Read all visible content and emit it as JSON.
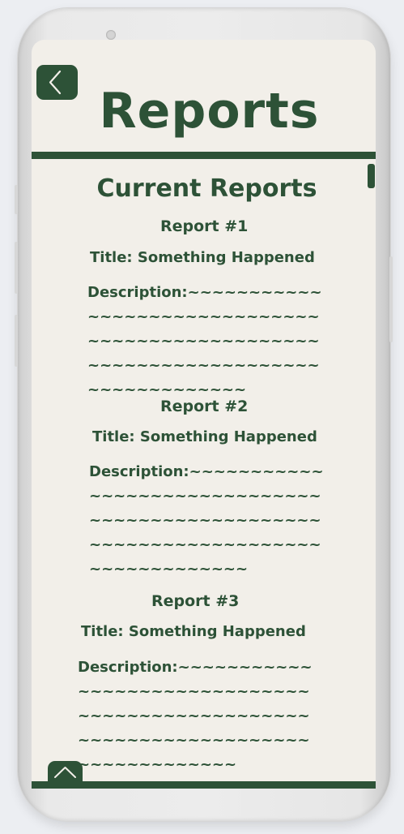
{
  "header": {
    "title": "Reports",
    "back_icon": "chevron-left-icon"
  },
  "section": {
    "title": "Current Reports"
  },
  "reports": [
    {
      "heading": "Report #1",
      "title": "Title: Something Happened",
      "description": "Description:~~~~~~~~~~~~~~~~~~~~~~~~~~~~~~~~~~~~~~~~~~~~~~~~~~~~~~~~~~~~~~~~~~~~~~~~~~~~~~~~~"
    },
    {
      "heading": "Report #2",
      "title": "Title: Something Happened",
      "description": "Description:~~~~~~~~~~~~~~~~~~~~~~~~~~~~~~~~~~~~~~~~~~~~~~~~~~~~~~~~~~~~~~~~~~~~~~~~~~~~~~~~~"
    },
    {
      "heading": "Report #3",
      "title": "Title: Something Happened",
      "description": "Description:~~~~~~~~~~~~~~~~~~~~~~~~~~~~~~~~~~~~~~~~~~~~~~~~~~~~~~~~~~~~~~~~~~~~~~~~~~~~~~~~~"
    }
  ],
  "footer": {
    "scroll_top_icon": "chevron-up-icon"
  },
  "colors": {
    "accent": "#2d5237",
    "background": "#f2efe9",
    "device": "#e9e9e9"
  }
}
